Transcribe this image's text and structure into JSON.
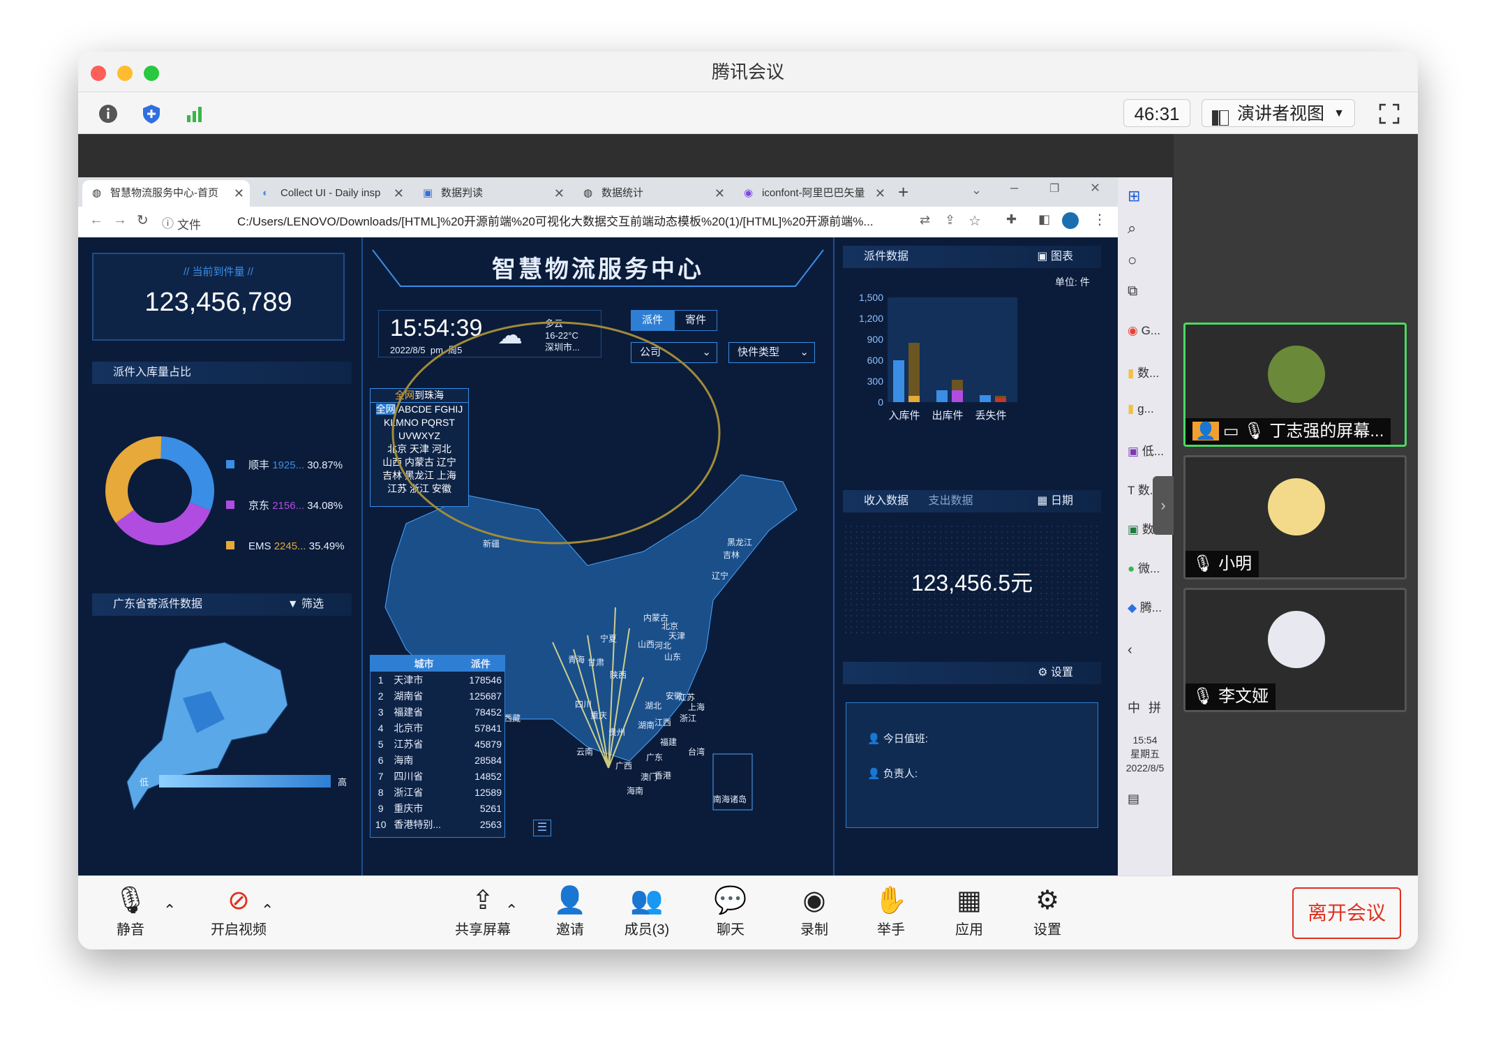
{
  "window": {
    "title": "腾讯会议"
  },
  "toolbar": {
    "timer": "46:31",
    "view_label": "演讲者视图"
  },
  "browser": {
    "tabs": [
      {
        "label": "智慧物流服务中心-首页"
      },
      {
        "label": "Collect UI - Daily insp"
      },
      {
        "label": "数据判读"
      },
      {
        "label": "数据统计"
      },
      {
        "label": "iconfont-阿里巴巴矢量"
      }
    ],
    "address_prefix": "文件",
    "url": "C:/Users/LENOVO/Downloads/[HTML]%20开源前端%20可视化大数据交互前端动态模板%20(1)/[HTML]%20开源前端%..."
  },
  "dashboard": {
    "title": "智慧物流服务中心",
    "current_label": "// 当前到件量 //",
    "current_value": "123,456,789",
    "time": "15:54:39",
    "date": "2022/8/5",
    "ampm": "pm",
    "weekday": "周5",
    "weather": "多云",
    "temp": "16-22°C",
    "city": "深圳市...",
    "toggle": [
      "派件",
      "寄件"
    ],
    "select1": "公司",
    "select2": "快件类型",
    "storage_title": "派件入库量占比",
    "donut": [
      {
        "name": "顺丰",
        "value": "1925...",
        "pct": "30.87%",
        "color": "#3a8ee6",
        "frac": 0.3087
      },
      {
        "name": "京东",
        "value": "2156...",
        "pct": "34.08%",
        "color": "#b04de0",
        "frac": 0.3408
      },
      {
        "name": "EMS",
        "value": "2245...",
        "pct": "35.49%",
        "color": "#e6a93a",
        "frac": 0.3549
      }
    ],
    "gd_title": "广东省寄派件数据",
    "gd_filter": "筛选",
    "gd_low": "低",
    "gd_high": "高",
    "search_panel": {
      "title_prefix": "全网",
      "title_suffix": "到珠海",
      "letters_active": "全网",
      "letters": [
        "ABCDE FGHIJ",
        "KLMNO PQRST",
        "UVWXYZ"
      ],
      "rows": [
        "北京 天津 河北",
        "山西 内蒙古 辽宁",
        "吉林 黑龙江 上海",
        "江苏 浙江 安徽"
      ]
    },
    "city_table": {
      "headers": [
        "城市",
        "派件"
      ],
      "rows": [
        [
          "1",
          "天津市",
          "178546"
        ],
        [
          "2",
          "湖南省",
          "125687"
        ],
        [
          "3",
          "福建省",
          "78452"
        ],
        [
          "4",
          "北京市",
          "57841"
        ],
        [
          "5",
          "江苏省",
          "45879"
        ],
        [
          "6",
          "海南",
          "28584"
        ],
        [
          "7",
          "四川省",
          "14852"
        ],
        [
          "8",
          "浙江省",
          "12589"
        ],
        [
          "9",
          "重庆市",
          "5261"
        ],
        [
          "10",
          "香港特别...",
          "2563"
        ]
      ]
    },
    "map_labels": {
      "xinjiang": "新疆",
      "xizang": "西藏",
      "qinghai": "青海",
      "gansu": "甘肃",
      "neimenggu": "内蒙古",
      "ningxia": "宁夏",
      "shanxi_shaanxi": "陕西",
      "shanxi": "山西",
      "beijing": "北京",
      "tianjin": "天津",
      "hebei": "河北",
      "shandong": "山东",
      "heilongjiang": "黑龙江",
      "jilin": "吉林",
      "liaoning": "辽宁",
      "sichuan": "四川",
      "chongqing": "重庆",
      "hubei": "湖北",
      "anhui": "安徽",
      "jiangsu": "江苏",
      "shanghai": "上海",
      "zhejiang": "浙江",
      "guizhou": "贵州",
      "hunan": "湖南",
      "jiangxi": "江西",
      "fujian": "福建",
      "taiwan": "台湾",
      "yunnan": "云南",
      "guangxi": "广西",
      "guangdong": "广东",
      "hongkong": "香港",
      "aomen": "澳门",
      "hainan": "海南",
      "nanhai": "南海诸岛"
    },
    "paijian_title": "派件数据",
    "paijian_chart_btn": "图表",
    "paijian_unit": "单位: 件",
    "income_tab": "收入数据",
    "expense_tab": "支出数据",
    "date_btn": "日期",
    "income_value": "123,456.5元",
    "settings_btn": "设置",
    "duty_label": "今日值班:",
    "owner_label": "负责人:"
  },
  "chart_data": {
    "type": "bar",
    "categories": [
      "入库件",
      "出库件",
      "丢失件"
    ],
    "ylim": [
      0,
      1500
    ],
    "yticks": [
      "1,500",
      "1,200",
      "900",
      "600",
      "300",
      "0"
    ],
    "series": [
      {
        "values": [
          600,
          170,
          100
        ],
        "color": "#3a8ee6"
      },
      {
        "values": [
          850,
          320,
          90
        ],
        "color": "#6b5520"
      }
    ],
    "extra_bars": [
      {
        "color": "#e6a93a",
        "value": 90
      },
      {
        "color": "#b04de0",
        "value": 170
      },
      {
        "color": "#c0392b",
        "value": 60
      }
    ]
  },
  "taskbar": {
    "items": [
      "G...",
      "数...",
      "g...",
      "低...",
      "数...",
      "数...",
      "微...",
      "腾..."
    ],
    "ime1": "中",
    "ime2": "拼",
    "time": "15:54",
    "weekday": "星期五",
    "date": "2022/8/5"
  },
  "participants": [
    {
      "name": "丁志强的屏幕...",
      "color": "#6a8a3a"
    },
    {
      "name": "小明",
      "color": "#f3d98a"
    },
    {
      "name": "李文娅",
      "color": "#e8e8f0"
    }
  ],
  "bottom": {
    "mute": "静音",
    "video": "开启视频",
    "share": "共享屏幕",
    "invite": "邀请",
    "members": "成员(3)",
    "chat": "聊天",
    "record": "录制",
    "raise": "举手",
    "apps": "应用",
    "settings": "设置",
    "leave": "离开会议"
  }
}
